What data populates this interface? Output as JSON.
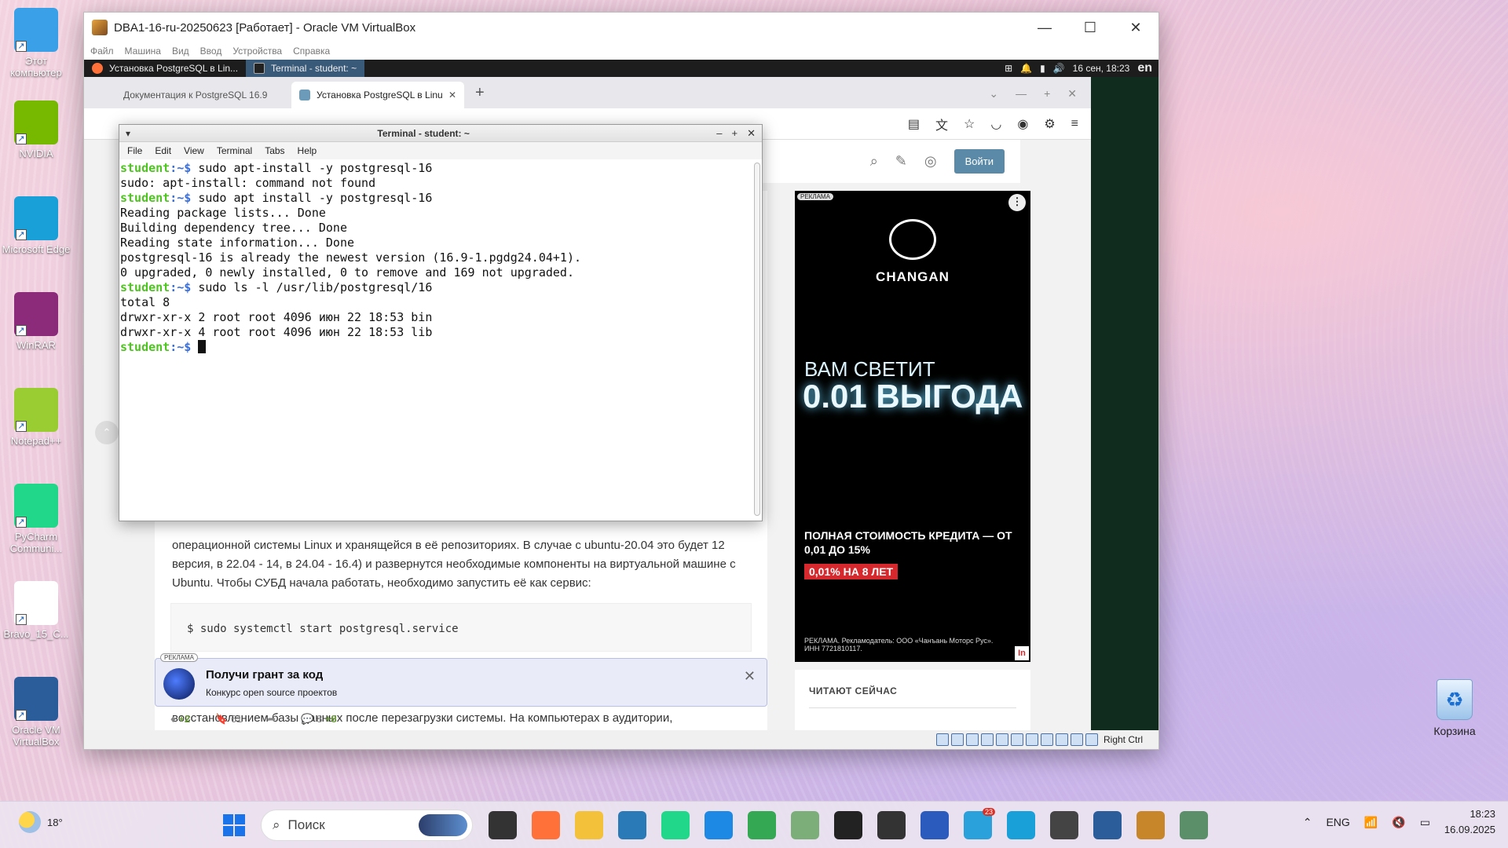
{
  "desktop": {
    "icons": [
      {
        "label": "Этот компьютер",
        "icon": "monitor-icon",
        "color": "#3aa0e8"
      },
      {
        "label": "NVIDIA",
        "icon": "nvidia-icon",
        "color": "#76b900"
      },
      {
        "label": "Microsoft Edge",
        "icon": "edge-icon",
        "color": "#1aa0d8"
      },
      {
        "label": "WinRAR",
        "icon": "winrar-icon",
        "color": "#8b2b7a"
      },
      {
        "label": "Notepad++",
        "icon": "notepadpp-icon",
        "color": "#9acd32"
      },
      {
        "label": "PyCharm Communi...",
        "icon": "pycharm-icon",
        "color": "#21d789"
      },
      {
        "label": "Bravo_15_C...",
        "icon": "document-icon",
        "color": "#ffffff"
      },
      {
        "label": "Oracle VM VirtualBox",
        "icon": "virtualbox-icon",
        "color": "#2a5d9a"
      }
    ],
    "recycle_bin": "Корзина"
  },
  "vbox": {
    "title": "DBA1-16-ru-20250623 [Работает] - Oracle VM VirtualBox",
    "menu": [
      "Файл",
      "Машина",
      "Вид",
      "Ввод",
      "Устройства",
      "Справка"
    ],
    "host_key": "Right Ctrl"
  },
  "guest_panel": {
    "tasks": [
      "Установка PostgreSQL в Lin...",
      "Terminal - student: ~"
    ],
    "datetime": "16 сен, 18:23",
    "lang": "en"
  },
  "firefox": {
    "tabs": [
      "Документация к PostgreSQL 16.9",
      "Установка PostgreSQL в Linu"
    ],
    "new_tab": "+"
  },
  "site": {
    "login_button": "Войти",
    "para1": "операционной системы Linux и хранящейся в её репозиториях. В случае с ubuntu-20.04 это будет 12 версия, в 22.04 - 14, в 24.04 - 16.4) и развернутся необходимые компоненты на виртуальной машине с Ubuntu. Чтобы СУБД начала работать, необходимо запустить её как сервис:",
    "code": "$ sudo systemctl start postgresql.service",
    "para2": "восстановлением базы данных после перезагрузки системы. На компьютерах в аудитории,",
    "ad_bar": {
      "badge": "РЕКЛАМА",
      "title": "Получи грант за код",
      "subtitle": "Конкурс open source проектов"
    },
    "stats": {
      "votes": "+2",
      "bookmarks": "61",
      "comments": "8",
      "new_comments": "+8"
    },
    "reading_now": "ЧИТАЮТ СЕЙЧАС",
    "side_ad": {
      "badge": "РЕКЛАМА",
      "brand": "CHANGAN",
      "headline1": "ВАМ СВЕТИТ",
      "headline2": "0.01 ВЫГОДА",
      "sub": "ПОЛНАЯ СТОИМОСТЬ КРЕДИТА — ОТ 0,01 ДО 15%",
      "offer": "0,01% НА 8 ЛЕТ",
      "legal": "РЕКЛАМА. Рекламодатель: ООО «Чанъань Моторс Рус». ИНН 7721810117.",
      "corner": "In"
    }
  },
  "terminal": {
    "title": "Terminal - student: ~",
    "menu": [
      "File",
      "Edit",
      "View",
      "Terminal",
      "Tabs",
      "Help"
    ],
    "prompt_user": "student",
    "prompt_path": ":~$",
    "lines": [
      {
        "type": "cmd",
        "text": " sudo apt-install -y postgresql-16"
      },
      {
        "type": "out",
        "text": "sudo: apt-install: command not found"
      },
      {
        "type": "cmd",
        "text": " sudo apt install -y postgresql-16"
      },
      {
        "type": "out",
        "text": "Reading package lists... Done"
      },
      {
        "type": "out",
        "text": "Building dependency tree... Done"
      },
      {
        "type": "out",
        "text": "Reading state information... Done"
      },
      {
        "type": "out",
        "text": "postgresql-16 is already the newest version (16.9-1.pgdg24.04+1)."
      },
      {
        "type": "out",
        "text": "0 upgraded, 0 newly installed, 0 to remove and 169 not upgraded."
      },
      {
        "type": "cmd",
        "text": " sudo ls -l /usr/lib/postgresql/16"
      },
      {
        "type": "out",
        "text": "total 8"
      },
      {
        "type": "out",
        "text": "drwxr-xr-x 2 root root 4096 июн 22 18:53 bin"
      },
      {
        "type": "out",
        "text": "drwxr-xr-x 4 root root 4096 июн 22 18:53 lib"
      },
      {
        "type": "prompt",
        "text": " "
      }
    ]
  },
  "taskbar": {
    "weather_temp": "18°",
    "search_placeholder": "Поиск",
    "apps": [
      {
        "icon": "task-view-icon",
        "color": "#333333"
      },
      {
        "icon": "firefox-icon",
        "color": "#ff7139"
      },
      {
        "icon": "file-explorer-icon",
        "color": "#f3c13a"
      },
      {
        "icon": "photos-icon",
        "color": "#2a7ab8"
      },
      {
        "icon": "pycharm-icon",
        "color": "#21d789"
      },
      {
        "icon": "vscode-icon",
        "color": "#1e88e5"
      },
      {
        "icon": "chrome-icon",
        "color": "#34a853"
      },
      {
        "icon": "app-icon",
        "color": "#7cae7a"
      },
      {
        "icon": "terminal-icon",
        "color": "#222222"
      },
      {
        "icon": "cmd-icon",
        "color": "#333333"
      },
      {
        "icon": "powershell-icon",
        "color": "#2b5bbd"
      },
      {
        "icon": "telegram-icon",
        "color": "#2aa1da",
        "badge": "23"
      },
      {
        "icon": "edge-icon",
        "color": "#1aa0d8"
      },
      {
        "icon": "app2-icon",
        "color": "#444444"
      },
      {
        "icon": "virtualbox-icon",
        "color": "#2a5d9a"
      },
      {
        "icon": "vbox-machine-icon",
        "color": "#c8862a"
      },
      {
        "icon": "app3-icon",
        "color": "#5a8f6a"
      }
    ],
    "lang": "ENG",
    "time": "18:23",
    "date": "16.09.2025"
  }
}
